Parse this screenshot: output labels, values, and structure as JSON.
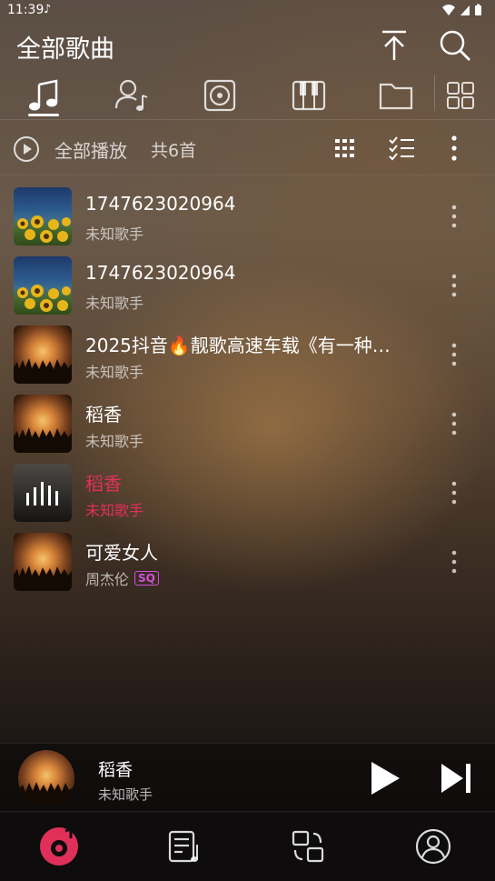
{
  "status": {
    "time": "11:39",
    "notification_icon": "music-note-icon",
    "icons": [
      "wifi-icon",
      "signal-icon",
      "battery-icon"
    ]
  },
  "header": {
    "title": "全部歌曲",
    "icons": [
      "scroll-top-icon",
      "search-icon"
    ]
  },
  "tabs": [
    {
      "name": "tab-songs",
      "icon": "music-note-icon",
      "active": true
    },
    {
      "name": "tab-artists",
      "icon": "artist-icon",
      "active": false
    },
    {
      "name": "tab-albums",
      "icon": "album-icon",
      "active": false
    },
    {
      "name": "tab-genres",
      "icon": "piano-icon",
      "active": false
    },
    {
      "name": "tab-folders",
      "icon": "folder-icon",
      "active": false
    },
    {
      "name": "tab-grid",
      "icon": "grid-icon",
      "active": false
    }
  ],
  "playbar": {
    "play_all_label": "全部播放",
    "count_label": "共6首"
  },
  "songs": [
    {
      "title": "1747623020964",
      "artist": "未知歌手",
      "cover": "sunflower",
      "active": false,
      "sq": false
    },
    {
      "title": "1747623020964",
      "artist": "未知歌手",
      "cover": "sunflower",
      "active": false,
      "sq": false
    },
    {
      "title": "2025抖音🔥靓歌高速车载《有一种…",
      "artist": "未知歌手",
      "cover": "sunset",
      "active": false,
      "sq": false
    },
    {
      "title": "稻香",
      "artist": "未知歌手",
      "cover": "sunset",
      "active": false,
      "sq": false
    },
    {
      "title": "稻香",
      "artist": "未知歌手",
      "cover": "bars",
      "active": true,
      "sq": false
    },
    {
      "title": "可爱女人",
      "artist": "周杰伦",
      "cover": "sunset",
      "active": false,
      "sq": true,
      "sq_label": "SQ"
    }
  ],
  "mini_player": {
    "title": "稻香",
    "artist": "未知歌手"
  },
  "bottom_nav": [
    {
      "name": "nav-music",
      "icon": "music-disc-icon",
      "active": true
    },
    {
      "name": "nav-playlist",
      "icon": "playlist-icon",
      "active": false
    },
    {
      "name": "nav-switch",
      "icon": "switch-icon",
      "active": false
    },
    {
      "name": "nav-profile",
      "icon": "profile-icon",
      "active": false
    }
  ],
  "colors": {
    "accent": "#e0305a",
    "sq_badge": "#d24fd8"
  }
}
